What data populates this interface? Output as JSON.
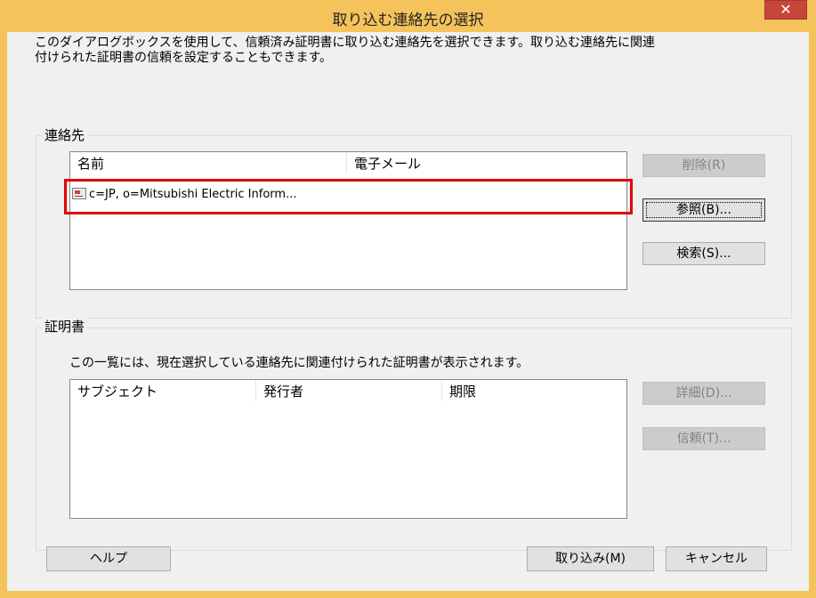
{
  "window": {
    "title": "取り込む連絡先の選択",
    "close_glyph": "✕"
  },
  "description": {
    "line1": "このダイアログボックスを使用して、信頼済み証明書に取り込む連絡先を選択できます。取り込む連絡先に関連",
    "line2": "付けられた証明書の信頼を設定することもできます。"
  },
  "contacts": {
    "group_label": "連絡先",
    "columns": [
      "名前",
      "電子メール"
    ],
    "rows": [
      {
        "name": "c=JP, o=Mitsubishi Electric Inform...",
        "email": "",
        "icon": "certificate-contact-icon"
      }
    ],
    "buttons": {
      "delete": "削除(R)",
      "browse": "参照(B)...",
      "search": "検索(S)..."
    }
  },
  "certificates": {
    "group_label": "証明書",
    "description": "この一覧には、現在選択している連絡先に関連付けられた証明書が表示されます。",
    "columns": [
      "サブジェクト",
      "発行者",
      "期限"
    ],
    "buttons": {
      "details": "詳細(D)...",
      "trust": "信頼(T)..."
    }
  },
  "footer": {
    "help": "ヘルプ",
    "import": "取り込み(M)",
    "cancel": "キャンセル"
  },
  "colors": {
    "title_bar": "#f5c35c",
    "close_button": "#c7463a",
    "highlight": "#e40000",
    "dialog_bg": "#f0f0f0"
  }
}
